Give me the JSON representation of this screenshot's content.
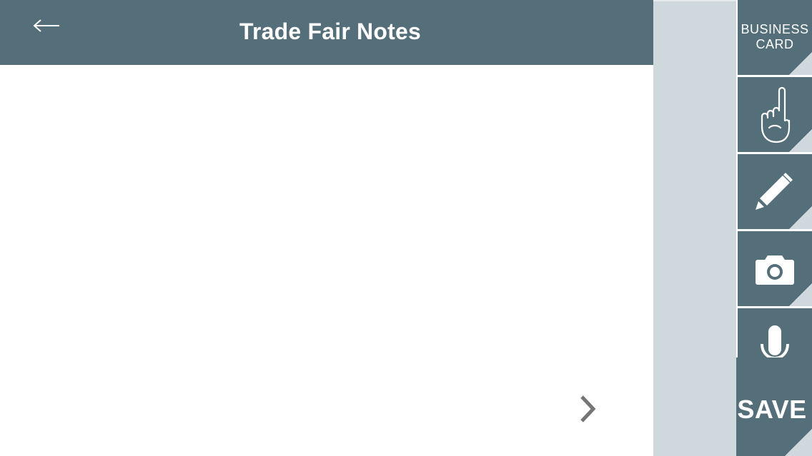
{
  "header": {
    "title": "Trade Fair Notes",
    "back_icon": "arrow-left-icon"
  },
  "main": {
    "next_icon": "chevron-right-icon"
  },
  "sidebar": {
    "business_card_label_line1": "BUSINESS",
    "business_card_label_line2": "CARD",
    "tiles": [
      {
        "name": "business-card",
        "icon": "business-card"
      },
      {
        "name": "gesture",
        "icon": "hand-pointing-icon"
      },
      {
        "name": "draw",
        "icon": "pencil-icon"
      },
      {
        "name": "photo",
        "icon": "camera-icon"
      },
      {
        "name": "voice",
        "icon": "microphone-icon"
      }
    ],
    "save_label": "SAVE"
  },
  "colors": {
    "primary": "#546e7a",
    "panel": "#cfd8dc",
    "background": "#ffffff",
    "chevron": "#757575"
  }
}
